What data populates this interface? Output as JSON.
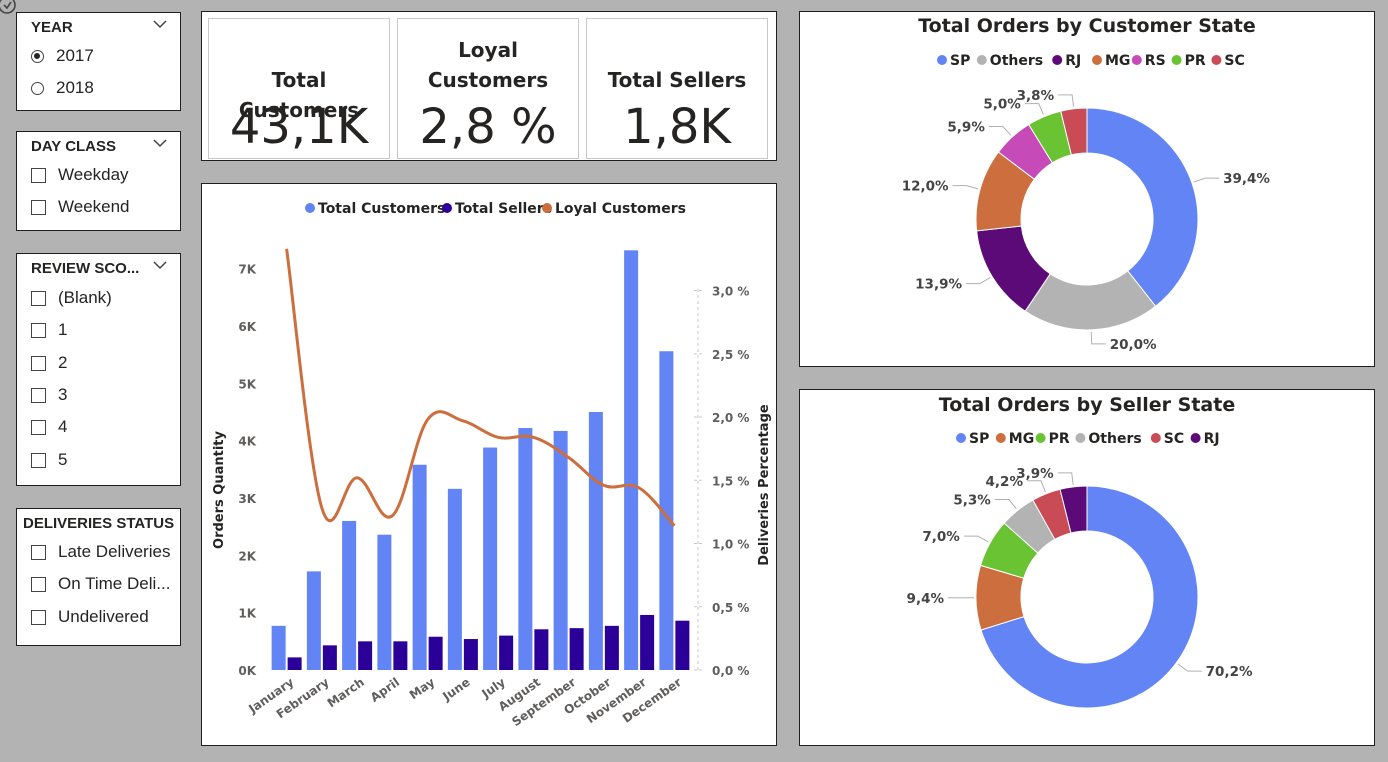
{
  "slicers": {
    "year": {
      "title": "YEAR",
      "options": [
        "2017",
        "2018"
      ],
      "selected": "2017"
    },
    "day_class": {
      "title": "DAY CLASS",
      "options": [
        "Weekday",
        "Weekend"
      ]
    },
    "review_score": {
      "title": "REVIEW SCO...",
      "options": [
        "(Blank)",
        "1",
        "2",
        "3",
        "4",
        "5"
      ]
    },
    "deliveries_status": {
      "title": "DELIVERIES STATUS",
      "options": [
        "Late Deliveries",
        "On Time Deli...",
        "Undelivered"
      ]
    }
  },
  "kpis": {
    "total_customers": {
      "label": "Total Customers",
      "value": "43,1K"
    },
    "loyal_customers": {
      "label_line1": "Loyal",
      "label_line2": "Customers",
      "value": "2,8 %"
    },
    "total_sellers": {
      "label": "Total Sellers",
      "value": "1,8K"
    }
  },
  "colors": {
    "blue": "#6284f5",
    "navy": "#2a0099",
    "orange": "#cc6e3d",
    "gray": "#b3b3b3",
    "purple": "#5b0a78",
    "pink": "#c64ab8",
    "green": "#6ac333",
    "red": "#c94b55"
  },
  "chart_data": [
    {
      "type": "bar",
      "title": "",
      "legend_position": "top",
      "categories": [
        "January",
        "February",
        "March",
        "April",
        "May",
        "June",
        "July",
        "August",
        "September",
        "October",
        "November",
        "December"
      ],
      "series": [
        {
          "name": "Total Customers",
          "axis": "left",
          "values": [
            770,
            1720,
            2600,
            2360,
            3580,
            3160,
            3880,
            4220,
            4170,
            4500,
            7320,
            5560
          ]
        },
        {
          "name": "Total Sellers",
          "axis": "left",
          "values": [
            220,
            430,
            500,
            500,
            580,
            540,
            600,
            710,
            730,
            770,
            960,
            860
          ]
        },
        {
          "name": "Loyal Customers",
          "axis": "right",
          "type": "line",
          "values": [
            3.33,
            1.28,
            1.52,
            1.22,
            1.98,
            1.97,
            1.84,
            1.84,
            1.68,
            1.46,
            1.44,
            1.14
          ]
        }
      ],
      "ylabel": "Orders Quantity",
      "ylabel_right": "Deliveries Percentage",
      "ylim": [
        0,
        7500
      ],
      "ylim_right": [
        0,
        3.4
      ],
      "yticks": [
        "0K",
        "1K",
        "2K",
        "3K",
        "4K",
        "5K",
        "6K",
        "7K"
      ],
      "yticks_right": [
        "0,0 %",
        "0,5 %",
        "1,0 %",
        "1,5 %",
        "2,0 %",
        "2,5 %",
        "3,0 %"
      ]
    },
    {
      "type": "pie",
      "donut": true,
      "title": "Total Orders by Customer State",
      "legend_position": "top",
      "slices": [
        {
          "name": "SP",
          "value": 39.4,
          "label": "39,4%",
          "color": "#6284f5"
        },
        {
          "name": "Others",
          "value": 20.0,
          "label": "20,0%",
          "color": "#b3b3b3"
        },
        {
          "name": "RJ",
          "value": 13.9,
          "label": "13,9%",
          "color": "#5b0a78"
        },
        {
          "name": "MG",
          "value": 12.0,
          "label": "12,0%",
          "color": "#cc6e3d"
        },
        {
          "name": "RS",
          "value": 5.9,
          "label": "5,9%",
          "color": "#c64ab8"
        },
        {
          "name": "PR",
          "value": 5.0,
          "label": "5,0%",
          "color": "#6ac333"
        },
        {
          "name": "SC",
          "value": 3.8,
          "label": "3,8%",
          "color": "#c94b55"
        }
      ]
    },
    {
      "type": "pie",
      "donut": true,
      "title": "Total Orders by Seller State",
      "legend_position": "top",
      "slices": [
        {
          "name": "SP",
          "value": 70.2,
          "label": "70,2%",
          "color": "#6284f5"
        },
        {
          "name": "MG",
          "value": 9.4,
          "label": "9,4%",
          "color": "#cc6e3d"
        },
        {
          "name": "PR",
          "value": 7.0,
          "label": "7,0%",
          "color": "#6ac333"
        },
        {
          "name": "Others",
          "value": 5.3,
          "label": "5,3%",
          "color": "#b3b3b3"
        },
        {
          "name": "SC",
          "value": 4.2,
          "label": "4,2%",
          "color": "#c94b55"
        },
        {
          "name": "RJ",
          "value": 3.9,
          "label": "3,9%",
          "color": "#5b0a78"
        }
      ]
    }
  ]
}
